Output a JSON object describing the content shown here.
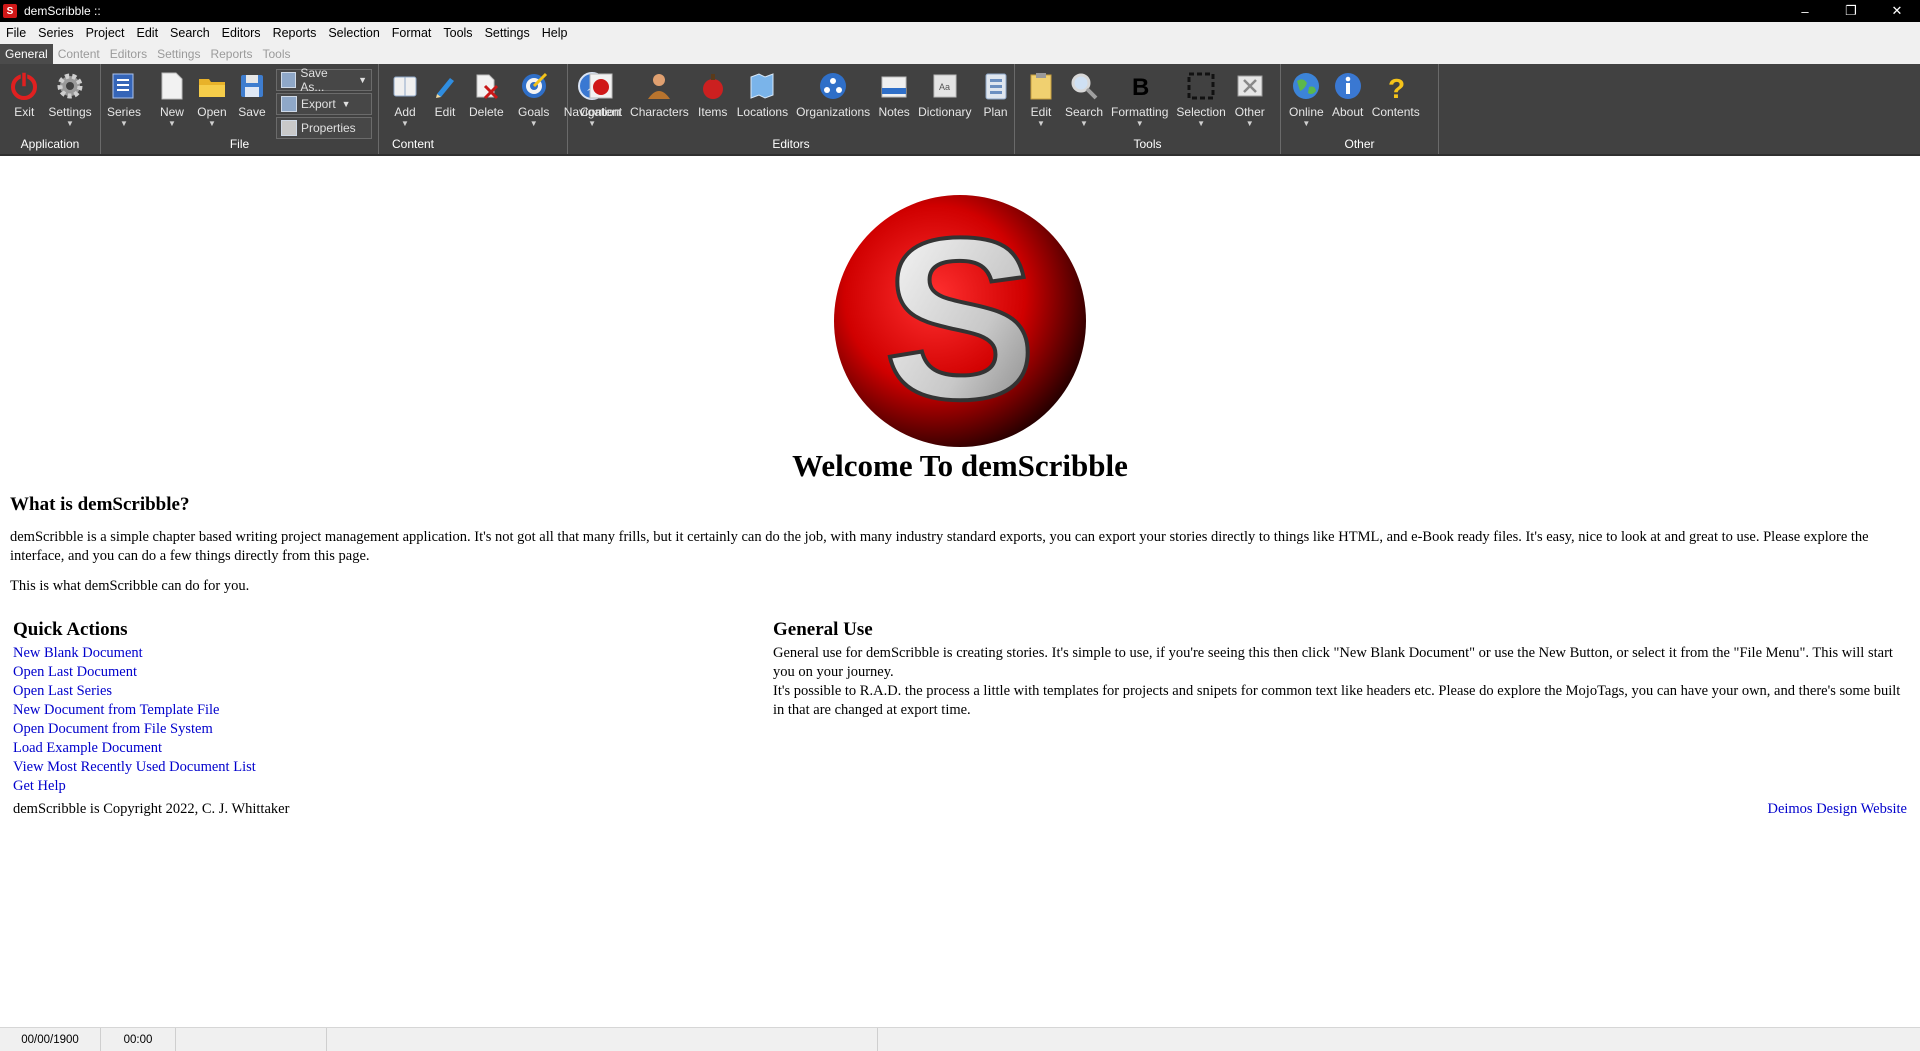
{
  "window": {
    "title": "demScribble ::",
    "controls": [
      "–",
      "❐",
      "✕"
    ],
    "app_icon_letter": "S"
  },
  "menu": [
    "File",
    "Series",
    "Project",
    "Edit",
    "Search",
    "Editors",
    "Reports",
    "Selection",
    "Format",
    "Tools",
    "Settings",
    "Help"
  ],
  "tabs": [
    {
      "label": "General",
      "active": true
    },
    {
      "label": "Content",
      "active": false
    },
    {
      "label": "Editors",
      "active": false
    },
    {
      "label": "Settings",
      "active": false
    },
    {
      "label": "Reports",
      "active": false
    },
    {
      "label": "Tools",
      "active": false
    }
  ],
  "ribbon": {
    "groups": [
      "Application",
      "File",
      "Content",
      "Editors",
      "Tools",
      "Other"
    ],
    "application": [
      "Exit",
      "Settings"
    ],
    "file": [
      "Series",
      "New",
      "Open",
      "Save"
    ],
    "file_small": [
      "Save As...",
      "Export",
      "Properties"
    ],
    "content": [
      "Add",
      "Edit",
      "Delete",
      "Goals",
      "Navigation"
    ],
    "editors": [
      "Content",
      "Characters",
      "Items",
      "Locations",
      "Organizations",
      "Notes",
      "Dictionary",
      "Plan"
    ],
    "tools": [
      "Edit",
      "Search",
      "Formatting",
      "Selection",
      "Other"
    ],
    "other": [
      "Online",
      "About",
      "Contents"
    ]
  },
  "page": {
    "logo_letter": "S",
    "welcome": "Welcome To demScribble",
    "what_heading": "What is demScribble?",
    "what_text": "demScribble is a simple chapter based writing project management application. It's not got all that many frills, but it certainly can do the job, with many industry standard exports, you can export your stories directly to things like HTML, and e-Book ready files. It's easy, nice to look at and great to use. Please explore the interface, and you can do a few things directly from this page.",
    "what_text2": "This is what demScribble can do for you.",
    "quick_actions_heading": "Quick Actions",
    "quick_actions": [
      "New Blank Document",
      "Open Last Document",
      "Open Last Series",
      "New Document from Template File",
      "Open Document from File System",
      "Load Example Document",
      "View Most Recently Used Document List",
      "Get Help"
    ],
    "copyright": "demScribble is Copyright 2022, C. J. Whittaker",
    "general_use_heading": "General Use",
    "general_use_p1": "General use for demScribble is creating stories. It's simple to use, if you're seeing this then click \"New Blank Document\" or use the New Button, or select it from the \"File Menu\". This will start you on your journey.",
    "general_use_p2": "It's possible to R.A.D. the process a little with templates for projects and snipets for common text like headers etc. Please do explore the MojoTags, you can have your own, and there's some built in that are changed at export time.",
    "website_link": "Deimos Design Website"
  },
  "status": {
    "date": "00/00/1900",
    "time": "00:00"
  },
  "colors": {
    "ribbon_bg": "#414141",
    "link": "#0000cc",
    "brand_red": "#d01818"
  }
}
